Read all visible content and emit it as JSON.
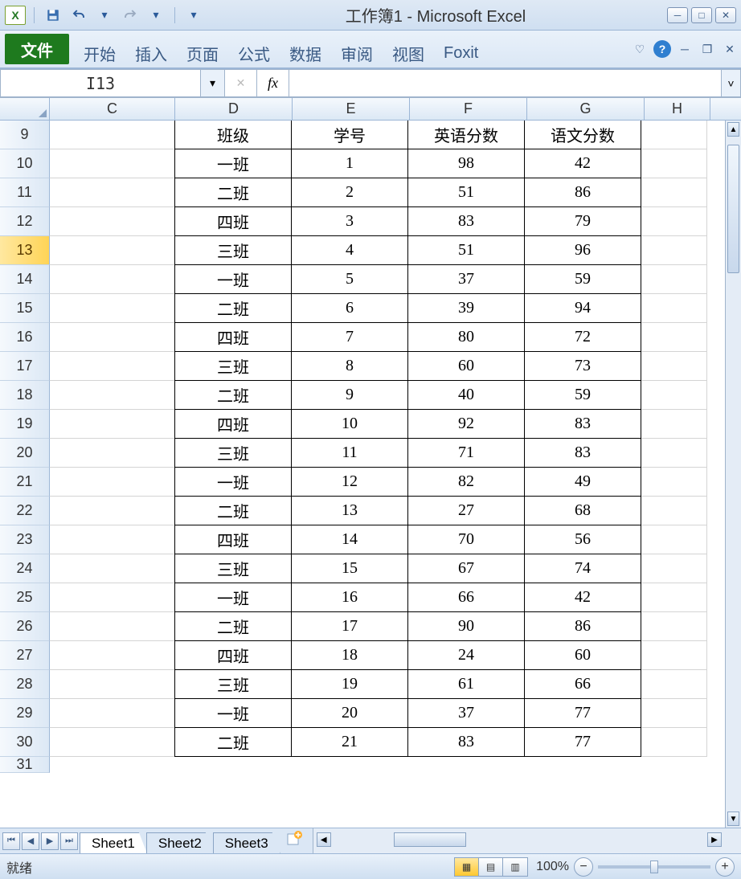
{
  "titlebar": {
    "title": "工作簿1 - Microsoft Excel"
  },
  "ribbon": {
    "file": "文件",
    "tabs": [
      "开始",
      "插入",
      "页面",
      "公式",
      "数据",
      "审阅",
      "视图",
      "Foxit"
    ]
  },
  "formulabar": {
    "namebox": "I13",
    "fx": "fx",
    "value": ""
  },
  "columns": [
    "C",
    "D",
    "E",
    "F",
    "G",
    "H"
  ],
  "selected_row": 13,
  "header_row": {
    "rownum": 9,
    "D": "班级",
    "E": "学号",
    "F": "英语分数",
    "G": "语文分数"
  },
  "rows": [
    {
      "n": 10,
      "D": "一班",
      "E": 1,
      "F": 98,
      "G": 42
    },
    {
      "n": 11,
      "D": "二班",
      "E": 2,
      "F": 51,
      "G": 86
    },
    {
      "n": 12,
      "D": "四班",
      "E": 3,
      "F": 83,
      "G": 79
    },
    {
      "n": 13,
      "D": "三班",
      "E": 4,
      "F": 51,
      "G": 96
    },
    {
      "n": 14,
      "D": "一班",
      "E": 5,
      "F": 37,
      "G": 59
    },
    {
      "n": 15,
      "D": "二班",
      "E": 6,
      "F": 39,
      "G": 94
    },
    {
      "n": 16,
      "D": "四班",
      "E": 7,
      "F": 80,
      "G": 72
    },
    {
      "n": 17,
      "D": "三班",
      "E": 8,
      "F": 60,
      "G": 73
    },
    {
      "n": 18,
      "D": "二班",
      "E": 9,
      "F": 40,
      "G": 59
    },
    {
      "n": 19,
      "D": "四班",
      "E": 10,
      "F": 92,
      "G": 83
    },
    {
      "n": 20,
      "D": "三班",
      "E": 11,
      "F": 71,
      "G": 83
    },
    {
      "n": 21,
      "D": "一班",
      "E": 12,
      "F": 82,
      "G": 49
    },
    {
      "n": 22,
      "D": "二班",
      "E": 13,
      "F": 27,
      "G": 68
    },
    {
      "n": 23,
      "D": "四班",
      "E": 14,
      "F": 70,
      "G": 56
    },
    {
      "n": 24,
      "D": "三班",
      "E": 15,
      "F": 67,
      "G": 74
    },
    {
      "n": 25,
      "D": "一班",
      "E": 16,
      "F": 66,
      "G": 42
    },
    {
      "n": 26,
      "D": "二班",
      "E": 17,
      "F": 90,
      "G": 86
    },
    {
      "n": 27,
      "D": "四班",
      "E": 18,
      "F": 24,
      "G": 60
    },
    {
      "n": 28,
      "D": "三班",
      "E": 19,
      "F": 61,
      "G": 66
    },
    {
      "n": 29,
      "D": "一班",
      "E": 20,
      "F": 37,
      "G": 77
    },
    {
      "n": 30,
      "D": "二班",
      "E": 21,
      "F": 83,
      "G": 77
    }
  ],
  "last_row": 31,
  "sheets": [
    "Sheet1",
    "Sheet2",
    "Sheet3"
  ],
  "active_sheet": 0,
  "statusbar": {
    "mode": "就绪",
    "zoom": "100%"
  }
}
